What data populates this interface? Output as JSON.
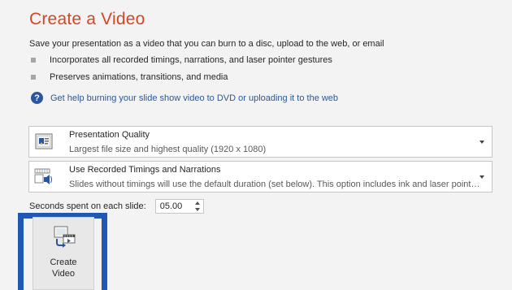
{
  "page": {
    "title": "Create a Video",
    "description": "Save your presentation as a video that you can burn to a disc, upload to the web, or email",
    "bullets": [
      "Incorporates all recorded timings, narrations, and laser pointer gestures",
      "Preserves animations, transitions, and media"
    ],
    "help_link": "Get help burning your slide show video to DVD or uploading it to the web"
  },
  "quality_dropdown": {
    "heading": "Presentation Quality",
    "subtext": "Largest file size and highest quality (1920 x 1080)",
    "icon": "presentation-quality-icon"
  },
  "timings_dropdown": {
    "heading": "Use Recorded Timings and Narrations",
    "subtext": "Slides without timings will use the default duration (set below). This option includes ink and laser pointer gestures.",
    "icon": "recorded-timings-icon"
  },
  "seconds": {
    "label": "Seconds spent on each slide:",
    "value": "05.00"
  },
  "create_button": {
    "label_line1": "Create",
    "label_line2": "Video",
    "icon": "create-video-icon"
  },
  "colors": {
    "title": "#d24726",
    "link": "#2b579a",
    "highlight": "#2057b3"
  }
}
